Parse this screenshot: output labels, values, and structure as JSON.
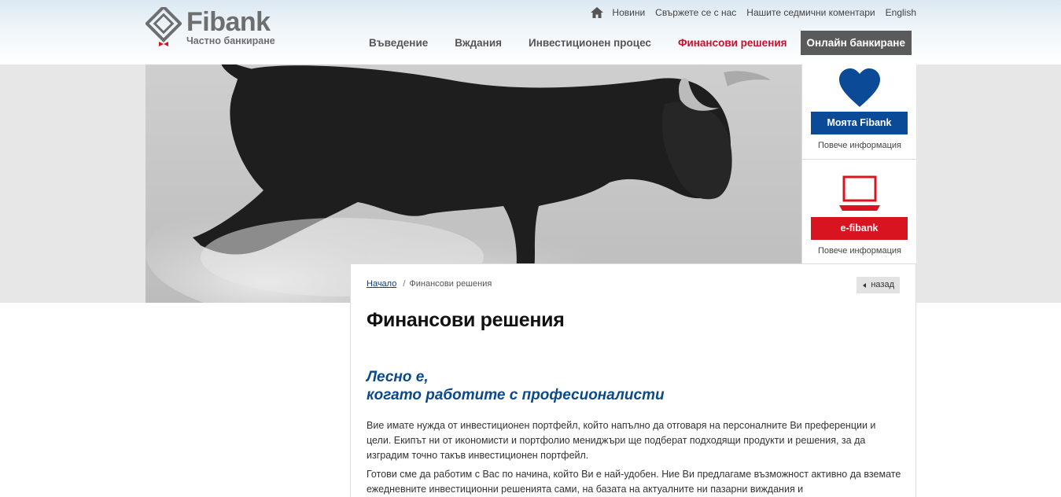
{
  "brand": {
    "name": "Fibank",
    "subtitle": "Частно банкиране",
    "colors": {
      "red": "#d7141f",
      "blue": "#0a4a96",
      "grey": "#6d6e70"
    }
  },
  "top_links": {
    "home_icon": "home-icon",
    "items": [
      "Новини",
      "Свържете се с нас",
      "Нашите седмични коментари",
      "English"
    ]
  },
  "main_nav": {
    "items": [
      "Въведение",
      "Вждания",
      "Инвестиционен процес",
      "Финансови решения"
    ],
    "active": "Финансови решения",
    "online": "Онлайн банкиране"
  },
  "side": {
    "box1": {
      "icon": "heart-icon",
      "button": "Моята Fibank",
      "more": "Повече информация"
    },
    "box2": {
      "icon": "laptop-icon",
      "button": "e-fibank",
      "more": "Повече информация"
    }
  },
  "breadcrumb": {
    "home": "Начало",
    "separator": "/",
    "current": "Финансови решения"
  },
  "back_button": "назад",
  "page_title": "Финансови решения",
  "tagline": {
    "line1": "Лесно е,",
    "line2": "когато работите с професионалисти"
  },
  "paragraphs": [
    "Вие имате нужда от инвестиционен портфейл, който напълно да отговаря на персоналните Ви преференции и цели. Екипът ни от икономисти и портфолио мениджъри ще подберат подходящи продукти и решения, за да изградим точно такъв инвестиционен портфейл.",
    "Готови сме да работим с Вас по начина, който Ви е най-удобен. Ние Ви предлагаме възможност активно да вземате ежедневните инвестиционни решенията сами, на базата на актуалните ни пазарни виждания и"
  ]
}
